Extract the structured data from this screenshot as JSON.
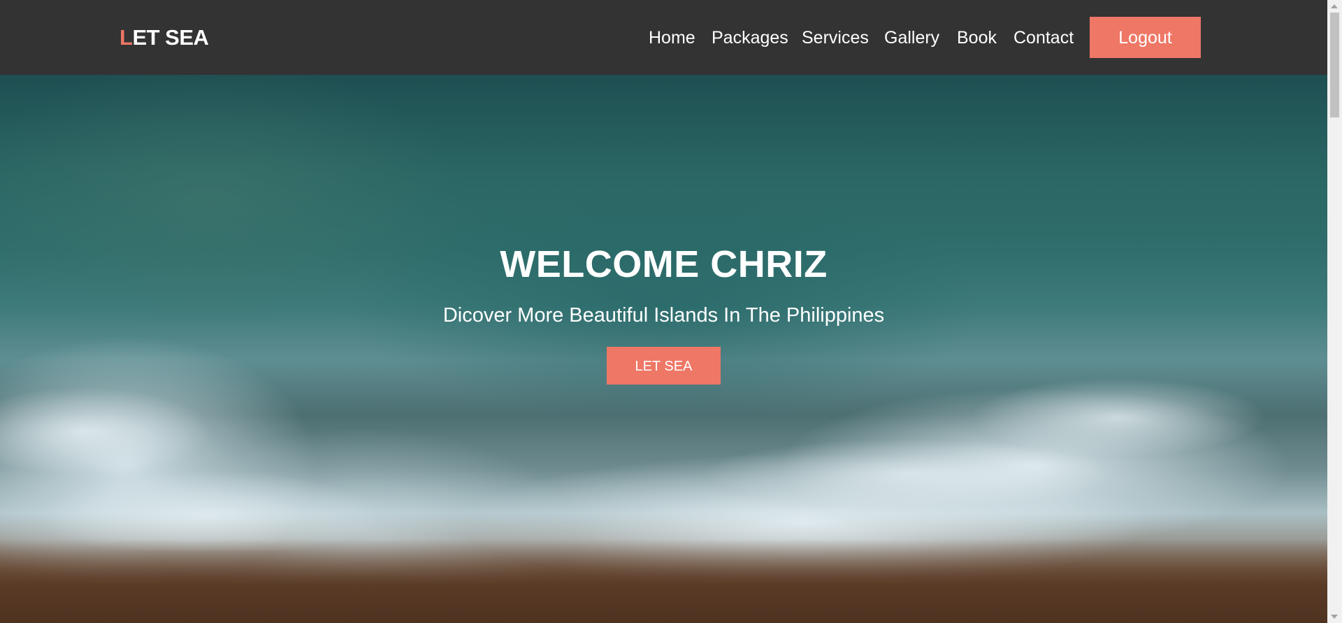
{
  "brand": {
    "first_letter": "L",
    "rest": "ET SEA"
  },
  "nav": {
    "items": [
      {
        "label": "Home"
      },
      {
        "label": "Packages"
      },
      {
        "label": "Services"
      },
      {
        "label": "Gallery"
      },
      {
        "label": "Book"
      },
      {
        "label": "Contact"
      }
    ],
    "logout_label": "Logout"
  },
  "hero": {
    "title": "WELCOME CHRIZ",
    "subtitle": "Dicover More Beautiful Islands In The Philippines",
    "cta_label": "LET SEA",
    "background": "aerial-ocean-waves-image"
  },
  "colors": {
    "accent": "#ee7766",
    "header_bg": "#333333",
    "text": "#ffffff"
  }
}
